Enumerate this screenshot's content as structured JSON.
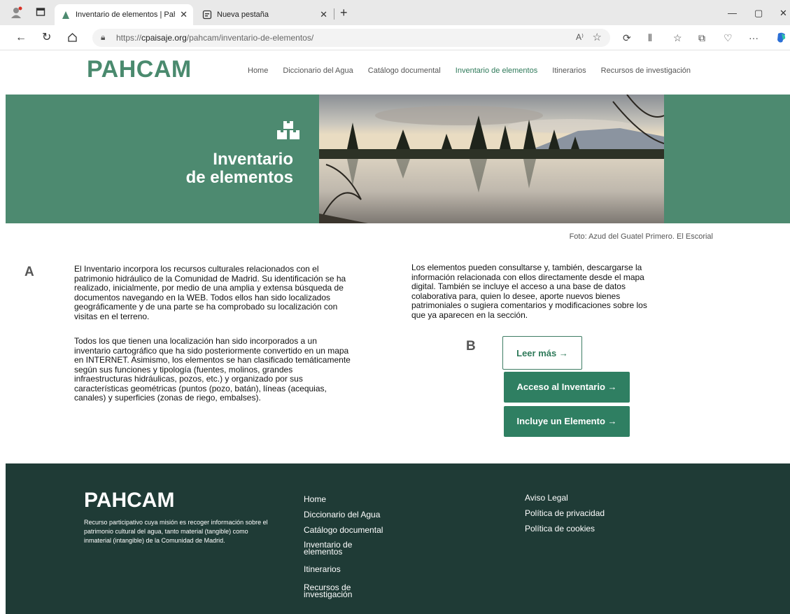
{
  "browser": {
    "tabs": [
      {
        "label": "Inventario de elementos | Pahcam",
        "active": true
      },
      {
        "label": "Nueva pestaña",
        "active": false
      }
    ],
    "new_tab_symbol": "+",
    "url_prefix": "https://",
    "url_domain": "cpaisaje.org",
    "url_path": "/pahcam/inventario-de-elementos/",
    "tab_close_symbol": "✕"
  },
  "site": {
    "logo": "PAHCAM",
    "nav": [
      "Home",
      "Diccionario del Agua",
      "Catálogo documental",
      "Inventario de elementos",
      "Itinerarios",
      "Recursos de investigación"
    ]
  },
  "hero": {
    "title_line1": "Inventario",
    "title_line2": "de elementos",
    "photo_caption": "Foto: Azud del Guatel Primero. El Escorial"
  },
  "annotations": {
    "a": "A",
    "b": "B"
  },
  "content": {
    "para1": "El Inventario incorpora los recursos culturales relacionados con el patrimonio hidráulico de la Comunidad de Madrid. Su identificación se ha realizado, inicialmente, por medio de una amplia y extensa búsqueda de documentos navegando en la WEB. Todos ellos han sido localizados geográficamente y de una parte se ha comprobado su localización con visitas en el terreno.",
    "para2": "Todos los que tienen una localización han sido incorporados a un inventario cartográfico que ha sido posteriormente convertido en un mapa en INTERNET. Asimismo, los elementos se han clasificado temáticamente según sus funciones y tipología (fuentes, molinos, grandes infraestructuras hidráulicas, pozos, etc.) y organizado por sus características geométricas (puntos (pozo, batán), líneas (acequias, canales) y superficies (zonas de riego, embalses).",
    "para3": "Los elementos pueden consultarse y, también, descargarse la información relacionada con ellos directamente desde el mapa digital. También se incluye el acceso a una base de datos colaborativa para, quien lo desee, aporte nuevos bienes patrimoniales o sugiera comentarios y modificaciones sobre los que ya aparecen en la sección.",
    "btn_read_more": "Leer más →",
    "btn_access": "Acceso al Inventario →",
    "btn_include": "Incluye un Elemento →"
  },
  "footer": {
    "logo": "PAHCAM",
    "description": "Recurso participativo cuya misión es recoger información sobre el patrimonio cultural del agua, tanto material (tangible) como inmaterial (intangible) de la Comunidad de Madrid.",
    "links": [
      "Home",
      "Diccionario del Agua",
      "Catálogo documental",
      "Inventario de elementos",
      "Itinerarios",
      "Recursos de investigación"
    ],
    "legal": [
      "Aviso Legal",
      "Política de privacidad",
      "Política de cookies"
    ]
  },
  "colors": {
    "brand": "#4d8a70",
    "button": "#2f7f62",
    "footer": "#1f3b36"
  }
}
